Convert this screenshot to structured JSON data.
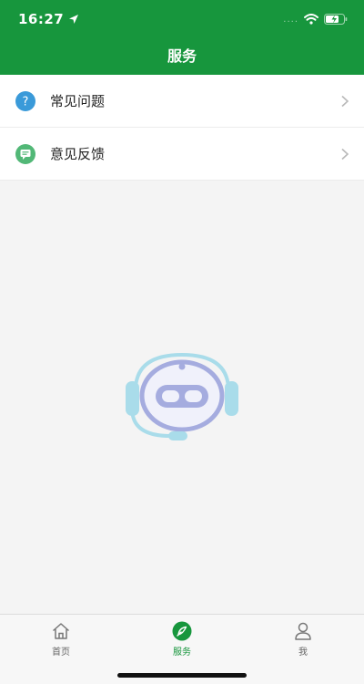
{
  "status_bar": {
    "time": "16:27",
    "signal_dots": "....",
    "icons": [
      "location-arrow-icon",
      "wifi-icon",
      "battery-charging-icon"
    ]
  },
  "header": {
    "title": "服务",
    "background_color": "#17963d"
  },
  "menu": {
    "items": [
      {
        "label": "常见问题",
        "icon": "question-icon",
        "icon_color": "#3a9ad9"
      },
      {
        "label": "意见反馈",
        "icon": "feedback-icon",
        "icon_color": "#52b877"
      }
    ]
  },
  "illustration": {
    "icon": "robot-headset-icon"
  },
  "tabbar": {
    "tabs": [
      {
        "label": "首页",
        "icon": "home-icon",
        "active": false
      },
      {
        "label": "服务",
        "icon": "compass-icon",
        "active": true
      },
      {
        "label": "我",
        "icon": "profile-icon",
        "active": false
      }
    ],
    "active_color": "#17963d"
  }
}
